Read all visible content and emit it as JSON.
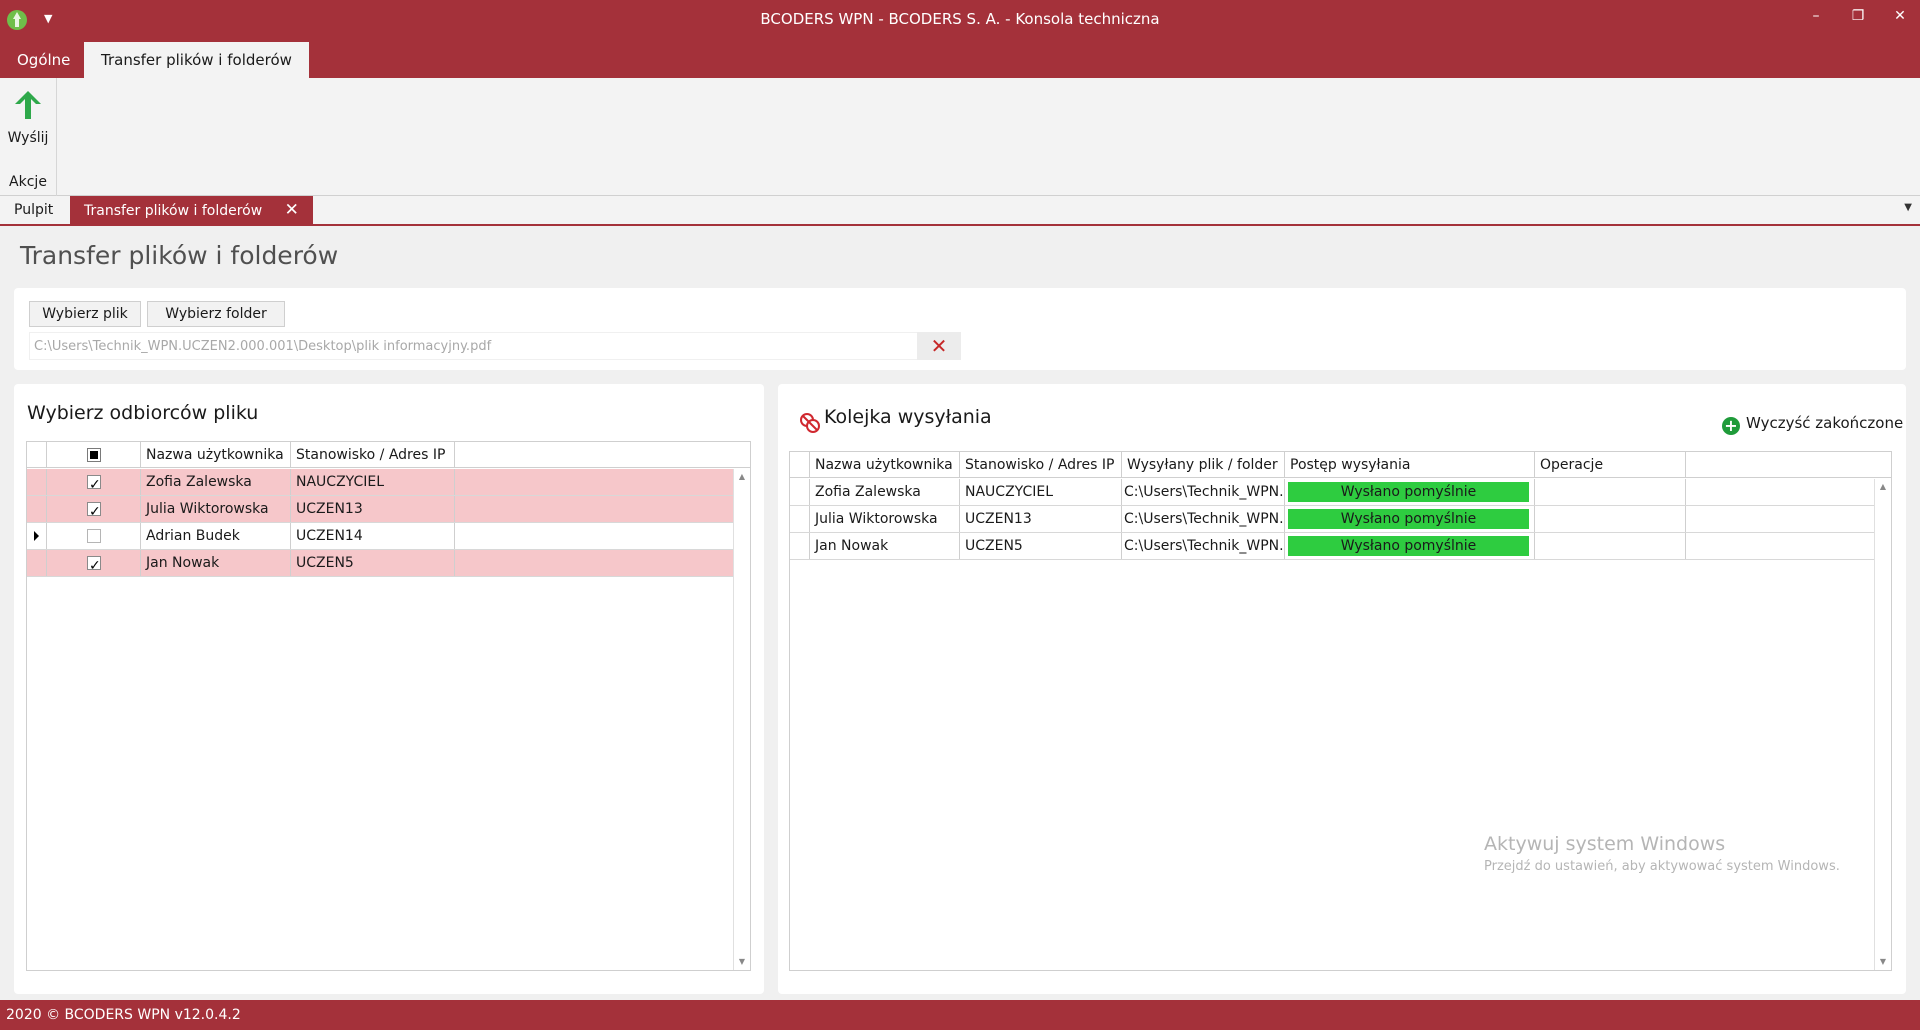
{
  "window": {
    "title": "BCODERS WPN - BCODERS S. A. - Konsola techniczna",
    "qa_dropdown_icon": "chevron-down-icon"
  },
  "ribbon": {
    "tabs": [
      {
        "label": "Ogólne",
        "active": false
      },
      {
        "label": "Transfer plików i folderów",
        "active": true
      }
    ],
    "send_label": "Wyślij",
    "group_label": "Akcje"
  },
  "doc_tabs": {
    "items": [
      {
        "label": "Pulpit",
        "active": false
      },
      {
        "label": "Transfer plików i folderów",
        "active": true
      }
    ]
  },
  "page": {
    "title": "Transfer plików i folderów",
    "choose_file_label": "Wybierz plik",
    "choose_folder_label": "Wybierz folder",
    "file_path": "C:\\Users\\Technik_WPN.UCZEN2.000.001\\Desktop\\plik informacyjny.pdf"
  },
  "recipients": {
    "title": "Wybierz odbiorców pliku",
    "columns": [
      "Nazwa użytkownika",
      "Stanowisko / Adres IP"
    ],
    "rows": [
      {
        "name": "Zofia Zalewska",
        "station": "NAUCZYCIEL",
        "checked": true
      },
      {
        "name": "Julia Wiktorowska",
        "station": "UCZEN13",
        "checked": true
      },
      {
        "name": "Adrian Budek",
        "station": "UCZEN14",
        "checked": false,
        "current": true
      },
      {
        "name": "Jan Nowak",
        "station": "UCZEN5",
        "checked": true
      }
    ]
  },
  "queue": {
    "title": "Kolejka wysyłania",
    "clear_label": "Wyczyść zakończone",
    "columns": [
      "Nazwa użytkownika",
      "Stanowisko / Adres IP",
      "Wysyłany plik / folder",
      "Postęp wysyłania",
      "Operacje"
    ],
    "rows": [
      {
        "name": "Zofia Zalewska",
        "station": "NAUCZYCIEL",
        "file": "C:\\Users\\Technik_WPN.U",
        "progress": "Wysłano pomyślnie",
        "progress_fraction": 1.0
      },
      {
        "name": "Julia Wiktorowska",
        "station": "UCZEN13",
        "file": "C:\\Users\\Technik_WPN.U",
        "progress": "Wysłano pomyślnie",
        "progress_fraction": 1.0
      },
      {
        "name": "Jan Nowak",
        "station": "UCZEN5",
        "file": "C:\\Users\\Technik_WPN.U",
        "progress": "Wysłano pomyślnie",
        "progress_fraction": 1.0
      }
    ]
  },
  "watermark": {
    "line1": "Aktywuj system Windows",
    "line2": "Przejdź do ustawień, aby aktywować system Windows."
  },
  "status": {
    "text": "2020 ©  BCODERS WPN v12.0.4.2"
  },
  "colors": {
    "brand": "#a4313a",
    "selected_row": "#f6c7ca",
    "progress_done": "#2ecc40"
  }
}
